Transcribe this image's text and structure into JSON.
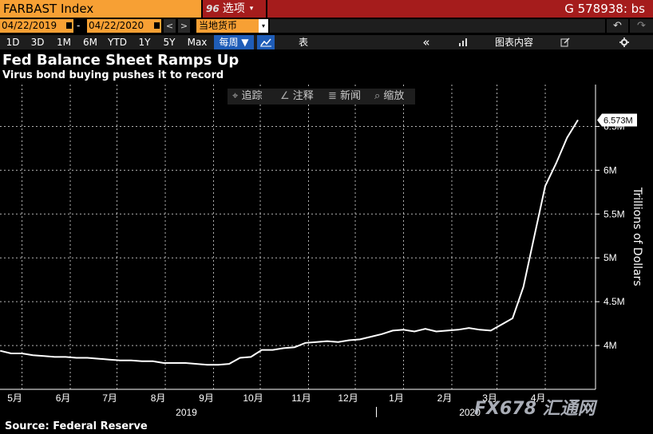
{
  "header": {
    "security": "FARBAST Index",
    "options_num": "96",
    "options_label": "选项",
    "options_caret": "▾",
    "function_code": "G 578938: bs"
  },
  "range": {
    "start": "04/22/2019",
    "dash": "-",
    "end": "04/22/2020",
    "prev": "<",
    "next": ">",
    "currency": "当地货币",
    "currency_dd": "▾",
    "undo": "↶",
    "redo": "↷"
  },
  "toolbar": {
    "periods": [
      "1D",
      "3D",
      "1M",
      "6M",
      "YTD",
      "1Y",
      "5Y",
      "Max"
    ],
    "frequency": "每周 ▼",
    "linechart_icon": "line-chart-icon",
    "table": "表",
    "collapse": "«",
    "chart_content": "图表内容",
    "edit_icon": "edit-icon",
    "settings_icon": "gear-icon"
  },
  "annotation_tools": {
    "track": "追踪",
    "annotate": "注释",
    "news": "新闻",
    "zoom": "缩放"
  },
  "source": "Source: Federal Reserve",
  "watermark": "FX678 汇通网",
  "colors": {
    "accent_orange": "#f7a034",
    "header_red": "#a51c1c",
    "selected_blue": "#1f5db8",
    "line": "#ffffff",
    "grid": "#ffffff"
  },
  "chart_data": {
    "type": "line",
    "title": "Fed Balance Sheet Ramps Up",
    "subtitle": "Virus bond buying pushes it to record",
    "ylabel": "Trillions of Dollars",
    "ylim": [
      3.5,
      6.75
    ],
    "y_ticks": [
      {
        "v": 4.0,
        "label": "4M"
      },
      {
        "v": 4.5,
        "label": "4.5M"
      },
      {
        "v": 5.0,
        "label": "5M"
      },
      {
        "v": 5.5,
        "label": "5.5M"
      },
      {
        "v": 6.0,
        "label": "6M"
      },
      {
        "v": 6.5,
        "label": "6.5M"
      }
    ],
    "x_start": "2019-04-22",
    "x_end": "2020-04-22",
    "x_ticks": [
      {
        "date": "2019-05-01",
        "label": "5月"
      },
      {
        "date": "2019-06-01",
        "label": "6月"
      },
      {
        "date": "2019-07-01",
        "label": "7月"
      },
      {
        "date": "2019-08-01",
        "label": "8月"
      },
      {
        "date": "2019-09-01",
        "label": "9月"
      },
      {
        "date": "2019-10-01",
        "label": "10月"
      },
      {
        "date": "2019-11-01",
        "label": "11月"
      },
      {
        "date": "2019-12-01",
        "label": "12月"
      },
      {
        "date": "2020-01-01",
        "label": "1月"
      },
      {
        "date": "2020-02-01",
        "label": "2月"
      },
      {
        "date": "2020-03-01",
        "label": "3月"
      },
      {
        "date": "2020-04-01",
        "label": "4月"
      }
    ],
    "year_labels": [
      {
        "date": "2019-09-01",
        "label": "2019"
      },
      {
        "date": "2020-03-01",
        "label": "2020"
      }
    ],
    "last_value_label": "6.573M",
    "last_value": 6.573,
    "series": [
      {
        "values": [
          {
            "x": "2019-04-17",
            "y": 3.94
          },
          {
            "x": "2019-04-24",
            "y": 3.91
          },
          {
            "x": "2019-05-01",
            "y": 3.91
          },
          {
            "x": "2019-05-08",
            "y": 3.89
          },
          {
            "x": "2019-05-15",
            "y": 3.88
          },
          {
            "x": "2019-05-22",
            "y": 3.87
          },
          {
            "x": "2019-05-29",
            "y": 3.87
          },
          {
            "x": "2019-06-05",
            "y": 3.86
          },
          {
            "x": "2019-06-12",
            "y": 3.86
          },
          {
            "x": "2019-06-19",
            "y": 3.85
          },
          {
            "x": "2019-06-26",
            "y": 3.84
          },
          {
            "x": "2019-07-03",
            "y": 3.83
          },
          {
            "x": "2019-07-10",
            "y": 3.83
          },
          {
            "x": "2019-07-17",
            "y": 3.82
          },
          {
            "x": "2019-07-24",
            "y": 3.82
          },
          {
            "x": "2019-07-31",
            "y": 3.8
          },
          {
            "x": "2019-08-07",
            "y": 3.8
          },
          {
            "x": "2019-08-14",
            "y": 3.8
          },
          {
            "x": "2019-08-21",
            "y": 3.79
          },
          {
            "x": "2019-08-28",
            "y": 3.78
          },
          {
            "x": "2019-09-04",
            "y": 3.78
          },
          {
            "x": "2019-09-11",
            "y": 3.79
          },
          {
            "x": "2019-09-18",
            "y": 3.86
          },
          {
            "x": "2019-09-25",
            "y": 3.87
          },
          {
            "x": "2019-10-02",
            "y": 3.95
          },
          {
            "x": "2019-10-09",
            "y": 3.95
          },
          {
            "x": "2019-10-16",
            "y": 3.97
          },
          {
            "x": "2019-10-23",
            "y": 3.98
          },
          {
            "x": "2019-10-30",
            "y": 4.03
          },
          {
            "x": "2019-11-06",
            "y": 4.04
          },
          {
            "x": "2019-11-13",
            "y": 4.05
          },
          {
            "x": "2019-11-20",
            "y": 4.04
          },
          {
            "x": "2019-11-27",
            "y": 4.06
          },
          {
            "x": "2019-12-04",
            "y": 4.07
          },
          {
            "x": "2019-12-11",
            "y": 4.1
          },
          {
            "x": "2019-12-18",
            "y": 4.13
          },
          {
            "x": "2019-12-25",
            "y": 4.17
          },
          {
            "x": "2020-01-01",
            "y": 4.18
          },
          {
            "x": "2020-01-08",
            "y": 4.16
          },
          {
            "x": "2020-01-15",
            "y": 4.19
          },
          {
            "x": "2020-01-22",
            "y": 4.16
          },
          {
            "x": "2020-01-29",
            "y": 4.17
          },
          {
            "x": "2020-02-05",
            "y": 4.18
          },
          {
            "x": "2020-02-12",
            "y": 4.2
          },
          {
            "x": "2020-02-19",
            "y": 4.18
          },
          {
            "x": "2020-02-26",
            "y": 4.17
          },
          {
            "x": "2020-03-04",
            "y": 4.24
          },
          {
            "x": "2020-03-11",
            "y": 4.31
          },
          {
            "x": "2020-03-18",
            "y": 4.67
          },
          {
            "x": "2020-03-25",
            "y": 5.25
          },
          {
            "x": "2020-04-01",
            "y": 5.82
          },
          {
            "x": "2020-04-08",
            "y": 6.08
          },
          {
            "x": "2020-04-15",
            "y": 6.37
          },
          {
            "x": "2020-04-22",
            "y": 6.573
          }
        ]
      }
    ],
    "grid": true,
    "legend": "none"
  }
}
